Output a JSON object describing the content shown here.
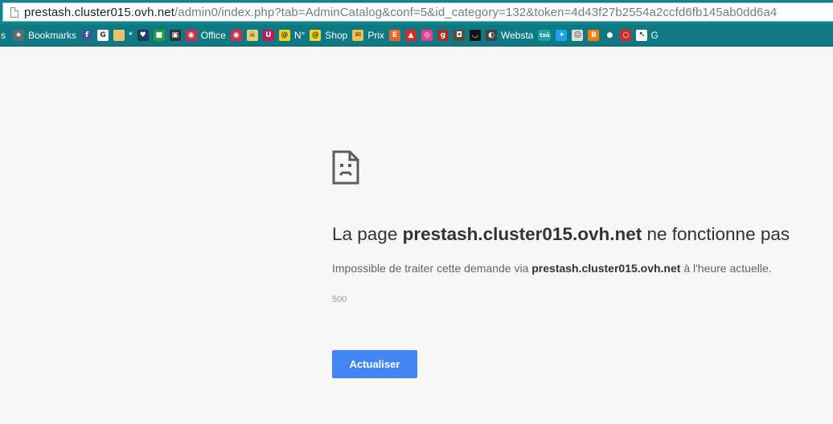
{
  "address_bar": {
    "host": "prestash.cluster015.ovh.net",
    "path": "/admin0/index.php?tab=AdminCatalog&conf=5&id_category=132&token=4d43f27b2554a2ccfd6fb145ab0dd6a4"
  },
  "bookmarks": {
    "leading_fragment": "s",
    "items": [
      {
        "icon": "star-icon",
        "label": "Bookmarks",
        "color": "#5a6b6e",
        "glyph": "★"
      },
      {
        "icon": "facebook-icon",
        "label": "",
        "color": "#3b5998",
        "glyph": "f"
      },
      {
        "icon": "google-icon",
        "label": "",
        "color": "#ffffff",
        "glyph": "G"
      },
      {
        "icon": "folder-icon",
        "label": "*",
        "color": "#e8c36a",
        "glyph": ""
      },
      {
        "icon": "heart-icon",
        "label": "",
        "color": "#1f3a5a",
        "glyph": "♥"
      },
      {
        "icon": "windows-icon",
        "label": "",
        "color": "#2d9b3a",
        "glyph": "■"
      },
      {
        "icon": "news-icon",
        "label": "",
        "color": "#333333",
        "glyph": "▣"
      },
      {
        "icon": "lips-icon",
        "label": "Office",
        "color": "#d32a4f",
        "glyph": "◉"
      },
      {
        "icon": "lips-icon-2",
        "label": "",
        "color": "#d32a4f",
        "glyph": "◉"
      },
      {
        "icon": "skull-icon",
        "label": "",
        "color": "#e8d36a",
        "glyph": "☠"
      },
      {
        "icon": "u-icon",
        "label": "",
        "color": "#c2185b",
        "glyph": "U"
      },
      {
        "icon": "laposte-icon",
        "label": "N°",
        "color": "#f3d21b",
        "glyph": "@"
      },
      {
        "icon": "laposte-icon-2",
        "label": "Shop",
        "color": "#f3d21b",
        "glyph": "@"
      },
      {
        "icon": "mail-icon",
        "label": "Prix",
        "color": "#f2c14e",
        "glyph": "✉"
      },
      {
        "icon": "etsy-icon",
        "label": "",
        "color": "#e8662a",
        "glyph": "E"
      },
      {
        "icon": "bag-icon",
        "label": "",
        "color": "#d62a2a",
        "glyph": "▲"
      },
      {
        "icon": "target-icon",
        "label": "",
        "color": "#e0408a",
        "glyph": "◎"
      },
      {
        "icon": "g-icon",
        "label": "",
        "color": "#b02a2a",
        "glyph": "g"
      },
      {
        "icon": "camera-icon",
        "label": "",
        "color": "#5a4a3a",
        "glyph": "◘"
      },
      {
        "icon": "smile-icon",
        "label": "",
        "color": "#111111",
        "glyph": "◡"
      },
      {
        "icon": "websta-icon",
        "label": "Websta",
        "color": "#444444",
        "glyph": "◐"
      },
      {
        "icon": "tsu-icon",
        "label": "",
        "color": "#1aa3a3",
        "glyph": "tsū"
      },
      {
        "icon": "twitter-icon",
        "label": "",
        "color": "#1da1f2",
        "glyph": "✦"
      },
      {
        "icon": "profile-icon",
        "label": "",
        "color": "#dddddd",
        "glyph": "☺"
      },
      {
        "icon": "blogger-icon",
        "label": "",
        "color": "#f57d00",
        "glyph": "B"
      },
      {
        "icon": "flickr-icon",
        "label": "",
        "color": "#0f7983",
        "glyph": "●"
      },
      {
        "icon": "circle-red-icon",
        "label": "",
        "color": "#d32a2a",
        "glyph": "○"
      },
      {
        "icon": "cursor-icon",
        "label": "",
        "color": "#ffffff",
        "glyph": "↖"
      }
    ],
    "trailing_fragment": "G"
  },
  "error_page": {
    "title_prefix": "La page ",
    "title_host": "prestash.cluster015.ovh.net",
    "title_suffix": " ne fonctionne pas",
    "desc_prefix": "Impossible de traiter cette demande via ",
    "desc_host": "prestash.cluster015.ovh.net",
    "desc_suffix": " à l'heure actuelle.",
    "error_code": "500",
    "reload_label": "Actualiser"
  },
  "colors": {
    "accent_button": "#4285f4",
    "toolbar": "#0f7983"
  }
}
